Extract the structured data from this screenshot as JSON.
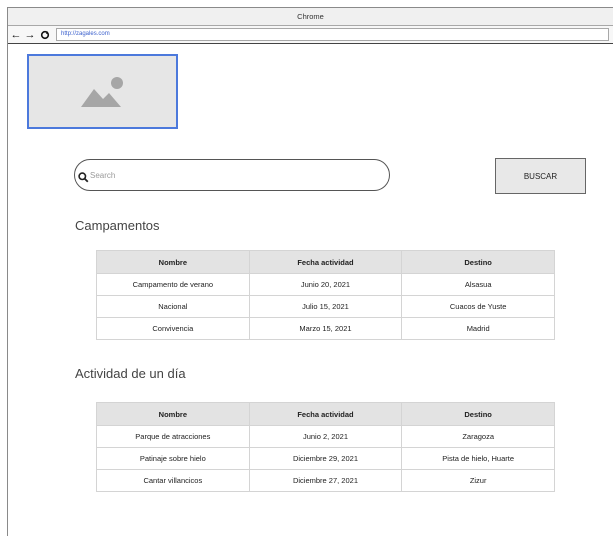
{
  "browser": {
    "title": "Chrome",
    "url": "http://zagales.com"
  },
  "search": {
    "placeholder": "Search",
    "button_label": "BUSCAR"
  },
  "sections": [
    {
      "title": "Campamentos",
      "headers": [
        "Nombre",
        "Fecha actividad",
        "Destino"
      ],
      "rows": [
        [
          "Campamento de verano",
          "Junio 20, 2021",
          "Alsasua"
        ],
        [
          "Nacional",
          "Julio 15, 2021",
          "Cuacos de Yuste"
        ],
        [
          "Convivencia",
          "Marzo 15, 2021",
          "Madrid"
        ]
      ]
    },
    {
      "title": "Actividad de un día",
      "headers": [
        "Nombre",
        "Fecha actividad",
        "Destino"
      ],
      "rows": [
        [
          "Parque de atracciones",
          "Junio 2, 2021",
          "Zaragoza"
        ],
        [
          "Patinaje sobre hielo",
          "Diciembre 29, 2021",
          "Pista de hielo, Huarte"
        ],
        [
          "Cantar villancicos",
          "Diciembre 27, 2021",
          "Zizur"
        ]
      ]
    }
  ],
  "icons": {
    "back": "back-arrow-icon",
    "forward": "forward-arrow-icon",
    "reload": "reload-icon",
    "search": "search-icon",
    "logo": "image-placeholder-icon"
  },
  "colors": {
    "logo_border": "#4c79dc",
    "header_bg": "#e3e3e3",
    "button_bg": "#e8e8e8"
  }
}
